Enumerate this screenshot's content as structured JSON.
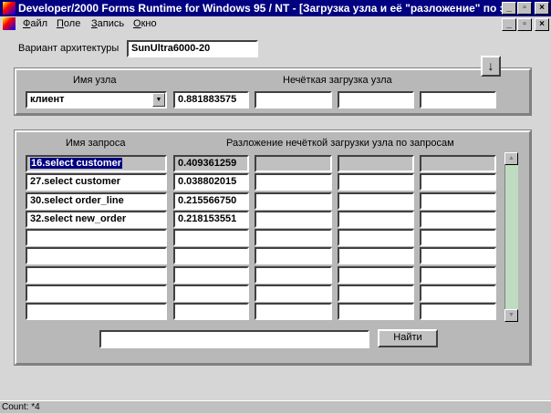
{
  "window": {
    "title": "Developer/2000 Forms Runtime for Windows 95 / NT - [Загрузка узла и её \"разложение\" по з...",
    "minimize": "_",
    "maximize": "▫",
    "close": "×"
  },
  "menu": [
    "Файл",
    "Поле",
    "Запись",
    "Окно"
  ],
  "architecture": {
    "label": "Вариант архитектуры",
    "value": "SunUltra6000-20"
  },
  "down_button": "↓",
  "node": {
    "name_label": "Имя узла",
    "load_label": "Нечёткая загрузка узла",
    "name_value": "клиент",
    "loads": [
      "0.881883575",
      "",
      "",
      ""
    ]
  },
  "queries": {
    "name_label": "Имя запроса",
    "decomp_label": "Разложение нечёткой загрузки узла по запросам",
    "rows": [
      {
        "name": "16.select customer",
        "values": [
          "0.409361259",
          "",
          "",
          ""
        ]
      },
      {
        "name": "27.select customer",
        "values": [
          "0.038802015",
          "",
          "",
          ""
        ]
      },
      {
        "name": "30.select order_line",
        "values": [
          "0.215566750",
          "",
          "",
          ""
        ]
      },
      {
        "name": "32.select new_order",
        "values": [
          "0.218153551",
          "",
          "",
          ""
        ]
      },
      {
        "name": "",
        "values": [
          "",
          "",
          "",
          ""
        ]
      },
      {
        "name": "",
        "values": [
          "",
          "",
          "",
          ""
        ]
      },
      {
        "name": "",
        "values": [
          "",
          "",
          "",
          ""
        ]
      },
      {
        "name": "",
        "values": [
          "",
          "",
          "",
          ""
        ]
      },
      {
        "name": "",
        "values": [
          "",
          "",
          "",
          ""
        ]
      }
    ]
  },
  "search": {
    "value": "",
    "button": "Найти"
  },
  "status": {
    "text": "Count: *4"
  }
}
